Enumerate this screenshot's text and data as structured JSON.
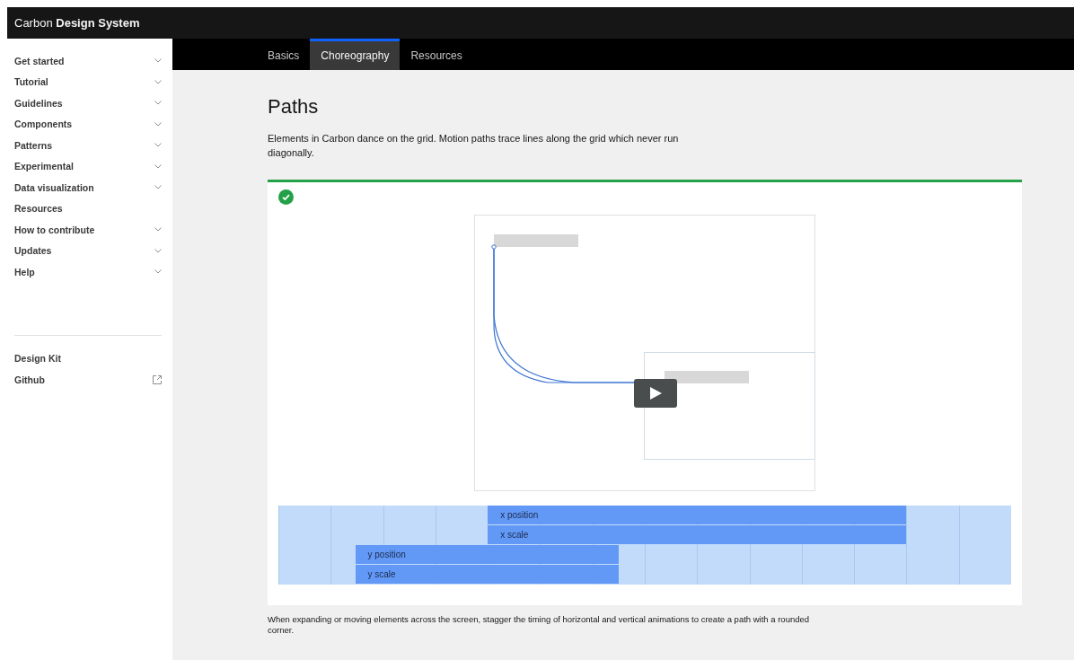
{
  "header": {
    "brand_light": "Carbon",
    "brand_bold": "Design System"
  },
  "sidebar": {
    "items": [
      {
        "label": "Get started",
        "expandable": true
      },
      {
        "label": "Tutorial",
        "expandable": true
      },
      {
        "label": "Guidelines",
        "expandable": true
      },
      {
        "label": "Components",
        "expandable": true
      },
      {
        "label": "Patterns",
        "expandable": true
      },
      {
        "label": "Experimental",
        "expandable": true
      },
      {
        "label": "Data visualization",
        "expandable": true
      },
      {
        "label": "Resources",
        "expandable": false
      },
      {
        "label": "How to contribute",
        "expandable": true
      },
      {
        "label": "Updates",
        "expandable": true
      },
      {
        "label": "Help",
        "expandable": true
      }
    ],
    "links": [
      {
        "label": "Design Kit",
        "external": false
      },
      {
        "label": "Github",
        "external": true
      }
    ]
  },
  "tabs": [
    {
      "label": "Basics",
      "selected": false
    },
    {
      "label": "Choreography",
      "selected": true
    },
    {
      "label": "Resources",
      "selected": false
    }
  ],
  "title": "Paths",
  "intro": "Elements in Carbon dance on the grid. Motion paths trace lines along the grid which never run diagonally.",
  "example": {
    "approved": true,
    "timeline": [
      {
        "label": "x position",
        "kind": "x"
      },
      {
        "label": "x scale",
        "kind": "x"
      },
      {
        "label": "y position",
        "kind": "y"
      },
      {
        "label": "y scale",
        "kind": "y"
      }
    ]
  },
  "caption": "When expanding or moving elements across the screen, stagger the timing of horizontal and vertical animations to create a path with a rounded corner."
}
